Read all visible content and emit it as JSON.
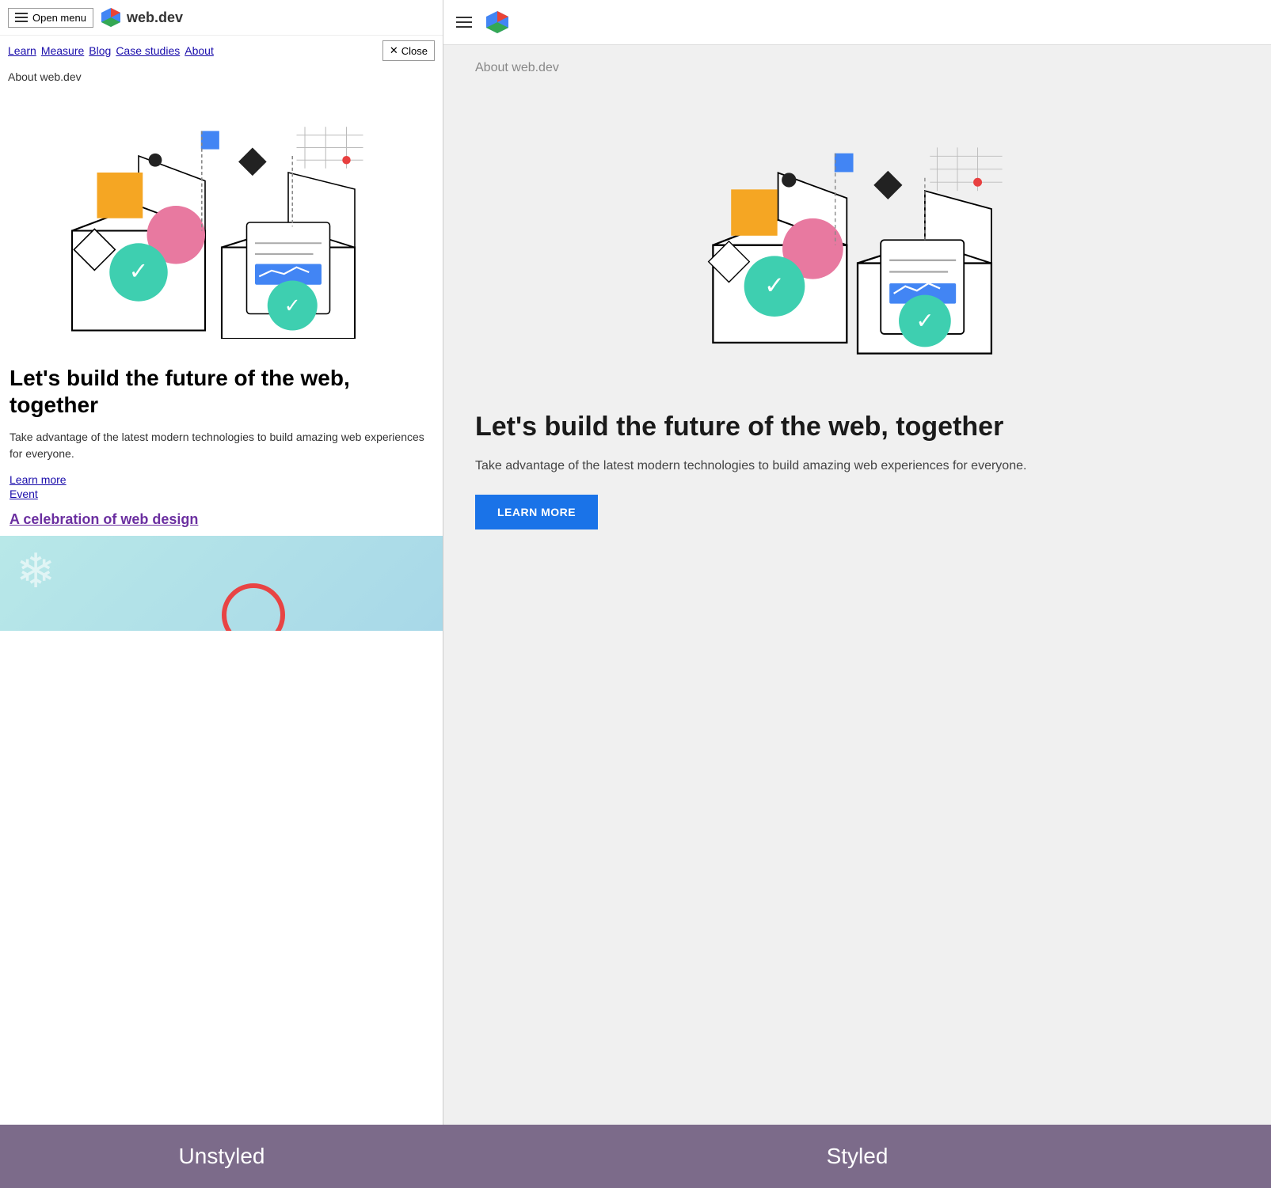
{
  "left_panel": {
    "nav": {
      "open_menu_label": "Open menu",
      "site_name": "web.dev",
      "nav_links": [
        "Learn",
        "Measure",
        "Blog",
        "Case studies",
        "About"
      ],
      "close_label": "Close"
    },
    "about_label": "About web.dev",
    "heading": "Let's build the future of the web, together",
    "description": "Take advantage of the latest modern technologies to build amazing web experiences for everyone.",
    "links": [
      "Learn more",
      "Event"
    ],
    "celebration_link": "A celebration of web design"
  },
  "right_panel": {
    "about_label": "About web.dev",
    "heading": "Let's build the future of the web, together",
    "description": "Take advantage of the latest modern technologies to build amazing web experiences for everyone.",
    "learn_more_btn": "LEARN MORE"
  },
  "bottom": {
    "left_label": "Unstyled",
    "right_label": "Styled"
  },
  "icons": {
    "hamburger": "☰",
    "close": "✕",
    "snowflake": "❄"
  }
}
